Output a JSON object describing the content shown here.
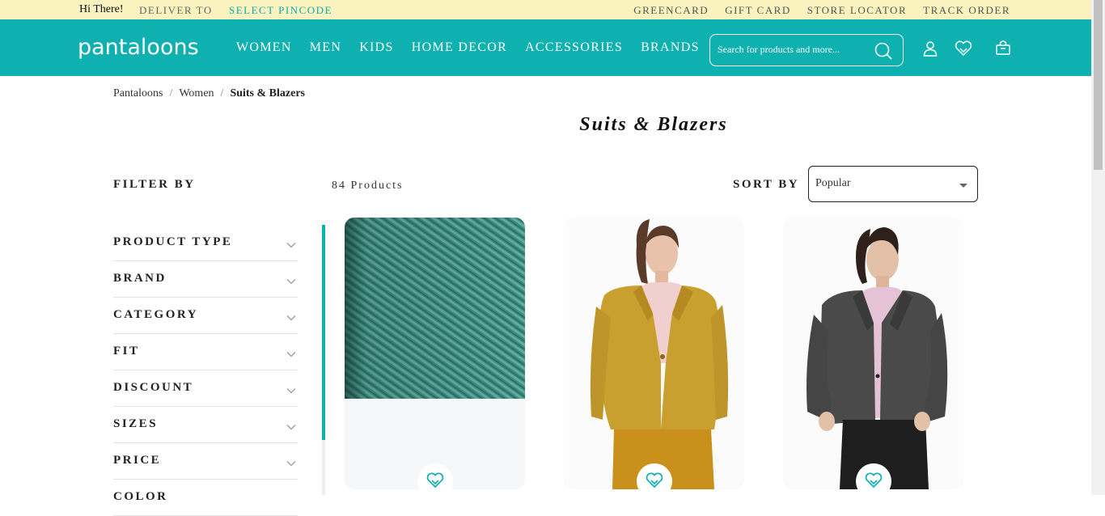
{
  "topbar": {
    "greeting": "Hi There!",
    "deliver_to": "DELIVER TO",
    "pincode": "SELECT PINCODE",
    "links": [
      "GREENCARD",
      "GIFT CARD",
      "STORE LOCATOR",
      "TRACK ORDER"
    ]
  },
  "nav": {
    "logo": "pantaloons",
    "menu": [
      "WOMEN",
      "MEN",
      "KIDS",
      "HOME DECOR",
      "ACCESSORIES",
      "BRANDS"
    ],
    "search_placeholder": "Search for products and more..."
  },
  "breadcrumb": {
    "items": [
      "Pantaloons",
      "Women"
    ],
    "current": "Suits & Blazers",
    "separator": "/"
  },
  "page_title": "Suits & Blazers",
  "filter_by": "FILTER BY",
  "product_count": "84 Products",
  "sort": {
    "label": "SORT BY",
    "value": "Popular"
  },
  "filters": [
    "PRODUCT TYPE",
    "BRAND",
    "CATEGORY",
    "FIT",
    "DISCOUNT",
    "SIZES",
    "PRICE",
    "COLOR"
  ],
  "colors": {
    "brand": "#0fb0b0",
    "topbar": "#faf3c0",
    "accent_text": "#13a8a8"
  },
  "products": [
    {
      "image": "teal-fabric-texture"
    },
    {
      "image": "woman-mustard-blazer"
    },
    {
      "image": "woman-grey-blazer"
    }
  ]
}
